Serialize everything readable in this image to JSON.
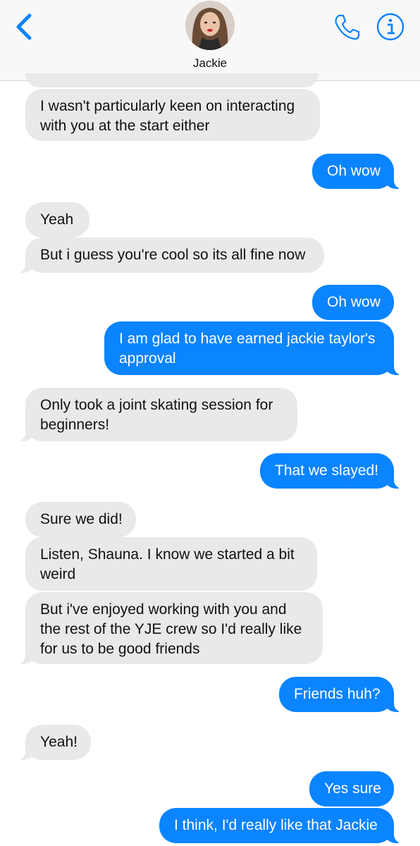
{
  "header": {
    "contact_name": "Jackie",
    "back_icon": "chevron-left-icon",
    "call_icon": "phone-icon",
    "info_icon": "info-icon"
  },
  "colors": {
    "accent": "#0a84ff",
    "incoming_bubble": "#e9e9eb",
    "header_bg": "#f8f8f8"
  },
  "messages": [
    {
      "from": "them",
      "lines": [
        "I wasn't particularly keen on interacting",
        "with you at the start either"
      ]
    },
    {
      "from": "me",
      "lines": [
        "Oh wow"
      ]
    },
    {
      "from": "them",
      "lines": [
        "Yeah"
      ]
    },
    {
      "from": "them",
      "lines": [
        "But i guess you're cool so its all fine now"
      ]
    },
    {
      "from": "me",
      "lines": [
        "Oh wow"
      ]
    },
    {
      "from": "me",
      "lines": [
        "I am glad to have earned jackie taylor's",
        "approval"
      ]
    },
    {
      "from": "them",
      "lines": [
        "Only took a joint skating session for",
        "beginners!"
      ]
    },
    {
      "from": "me",
      "lines": [
        "That we slayed!"
      ]
    },
    {
      "from": "them",
      "lines": [
        "Sure we did!"
      ]
    },
    {
      "from": "them",
      "lines": [
        "Listen, Shauna. I know we started a bit",
        "weird"
      ]
    },
    {
      "from": "them",
      "lines": [
        "But i've enjoyed working with you and",
        "the rest of the YJE crew so I'd really like",
        "for us to be good friends"
      ]
    },
    {
      "from": "me",
      "lines": [
        "Friends huh?"
      ]
    },
    {
      "from": "them",
      "lines": [
        "Yeah!"
      ]
    },
    {
      "from": "me",
      "lines": [
        "Yes sure"
      ]
    },
    {
      "from": "me",
      "lines": [
        "I think, I'd really like that Jackie"
      ]
    }
  ]
}
